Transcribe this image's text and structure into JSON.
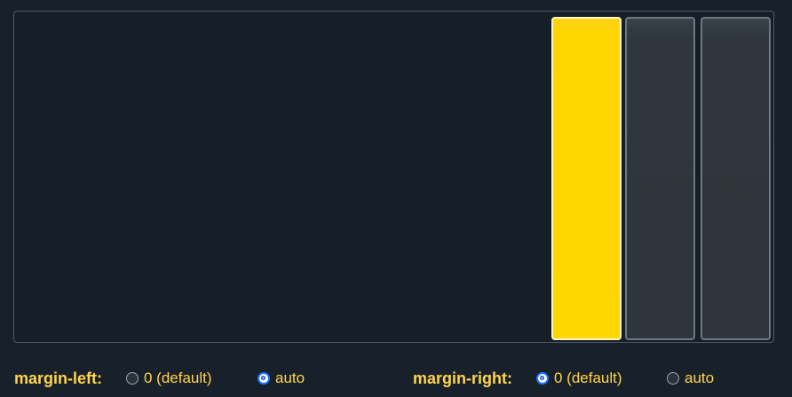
{
  "boxes": [
    {
      "name": "box-1",
      "state": "selected",
      "color": "#ffd700"
    },
    {
      "name": "box-2",
      "state": "default",
      "color": "#2e353c"
    },
    {
      "name": "box-3",
      "state": "default",
      "color": "#2e353c"
    }
  ],
  "controls": {
    "margin_left": {
      "label": "margin-left:",
      "options": [
        {
          "label": "0 (default)",
          "checked": false
        },
        {
          "label": "auto",
          "checked": true
        }
      ]
    },
    "margin_right": {
      "label": "margin-right:",
      "options": [
        {
          "label": "0 (default)",
          "checked": true
        },
        {
          "label": "auto",
          "checked": false
        }
      ]
    }
  },
  "colors": {
    "background": "#18202a",
    "accent_text": "#ffd54a",
    "selected_box": "#ffd700",
    "radio_checked": "#1a73ff"
  }
}
